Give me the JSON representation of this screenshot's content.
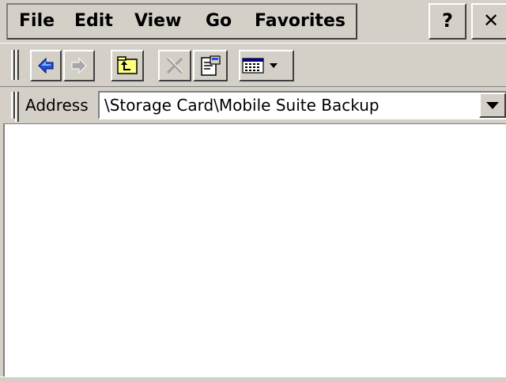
{
  "menu": {
    "items": [
      {
        "label": "File"
      },
      {
        "label": "Edit"
      },
      {
        "label": "View"
      },
      {
        "label": "Go"
      },
      {
        "label": "Favorites"
      }
    ]
  },
  "title_buttons": {
    "help_label": "?",
    "close_label": "✕"
  },
  "toolbar": {
    "buttons": [
      {
        "icon": "back-arrow-icon",
        "enabled": true
      },
      {
        "icon": "forward-arrow-icon",
        "enabled": false
      },
      {
        "icon": "up-folder-icon",
        "enabled": true
      },
      {
        "icon": "delete-icon",
        "enabled": false
      },
      {
        "icon": "properties-icon",
        "enabled": true
      },
      {
        "icon": "view-menu-icon",
        "enabled": true
      }
    ]
  },
  "address": {
    "label": "Address",
    "value": "\\Storage Card\\Mobile Suite Backup"
  },
  "colors": {
    "face": "#d4d0c8",
    "content_bg": "#ffffff",
    "arrow_blue": "#2050e0",
    "folder_yellow": "#ffff80"
  }
}
